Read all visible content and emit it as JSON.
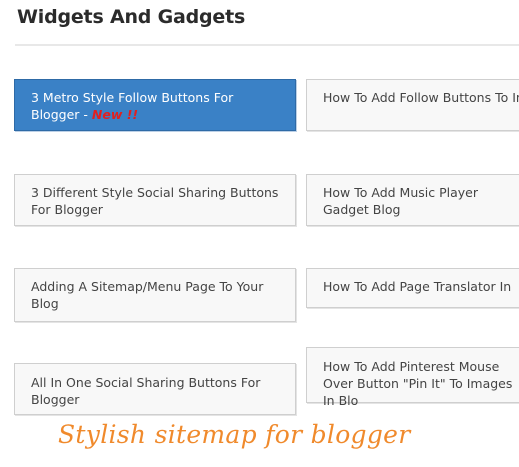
{
  "header": {
    "title": "Widgets And Gadgets"
  },
  "posts": [
    {
      "title": "3 Metro Style Follow Buttons For Blogger",
      "separator": "-",
      "badge": "New !!",
      "active": true
    },
    {
      "title": "How To Add Follow Buttons To In Blogger"
    },
    {
      "title": "3 Different Style Social Sharing Buttons For Blogger"
    },
    {
      "title": "How To Add Music Player Gadget Blog"
    },
    {
      "title": "Adding A Sitemap/Menu Page To Your Blog"
    },
    {
      "title": "How To Add Page Translator In"
    },
    {
      "title": "All In One Social Sharing Buttons For Blogger"
    },
    {
      "title": "How To Add Pinterest Mouse Over Button \"Pin It\" To Images In Blo"
    }
  ],
  "caption": "Stylish sitemap for blogger",
  "colors": {
    "active_card_bg": "#3a81c6",
    "badge": "#e02020",
    "caption": "#f08a2c"
  }
}
